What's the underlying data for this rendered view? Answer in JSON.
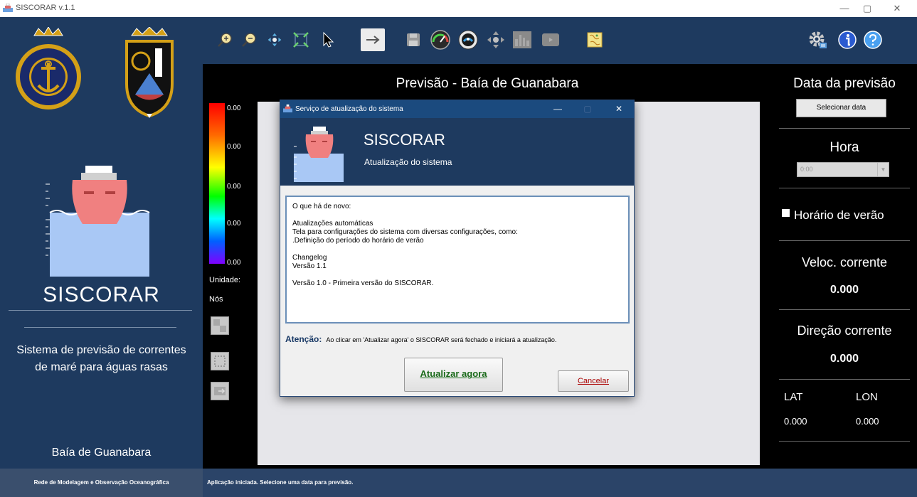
{
  "window": {
    "title": "SISCORAR v.1.1",
    "controls": {
      "minimize": "—",
      "maximize": "▢",
      "close": "✕"
    }
  },
  "sidebar": {
    "app_name": "SISCORAR",
    "description_line1": "Sistema de previsão de correntes",
    "description_line2": "de maré para águas rasas",
    "region": "Baía de Guanabara",
    "logos": [
      "marinha-do-brasil-emblem",
      "navy-ship-crest"
    ]
  },
  "toolbar": {
    "icons": [
      "zoom-in-icon",
      "zoom-out-icon",
      "pan-icon",
      "zoom-extent-icon",
      "pointer-icon",
      "arrow-icon",
      "save-icon",
      "speedometer-icon",
      "animation-icon",
      "move-icon",
      "chart-icon",
      "screen-icon",
      "map-icon",
      "settings-icon",
      "info-icon",
      "help-icon"
    ]
  },
  "main": {
    "title": "Previsão - Baía de Guanabara",
    "legend_values": [
      "0.00",
      "0.00",
      "0.00",
      "0.00",
      "0.00"
    ],
    "unit_label": "Unidade:",
    "unit_value": "Nós"
  },
  "right_panel": {
    "forecast_date_title": "Data da previsão",
    "select_date_button": "Selecionar data",
    "hour_title": "Hora",
    "hour_value": "0:00",
    "dst_label": "Horário de verão",
    "speed_title": "Veloc. corrente",
    "speed_value": "0.000",
    "direction_title": "Direção corrente",
    "direction_value": "0.000",
    "lat_label": "LAT",
    "lon_label": "LON",
    "lat_value": "0.000",
    "lon_value": "0.000"
  },
  "status": {
    "left": "Rede de Modelagem e Observação Oceanográfica",
    "message": "Aplicação iniciada. Selecione uma data para previsão."
  },
  "dialog": {
    "title": "Serviço de atualização do sistema",
    "app_name": "SISCORAR",
    "subtitle": "Atualização do sistema",
    "text_lines": {
      "l1": "O que há de novo:",
      "l2": "Atualizações automáticas",
      "l3": "Tela para configurações do sistema com diversas configurações, como:",
      "l4": ".Definição do período do horário de verão",
      "l5": "Changelog",
      "l6": "Versão 1.1",
      "l7": " Versão 1.0 - Primeira versão do SISCORAR."
    },
    "warning_label": "Atenção:",
    "warning_text": "Ao clicar em 'Atualizar agora' o SISCORAR será fechado e iniciará a atualização.",
    "update_button": "Atualizar agora",
    "cancel_button": "Cancelar"
  },
  "colors": {
    "navy": "#1e3a5f",
    "dialog_titlebar": "#1b4a7e",
    "ship_hull": "#f08080",
    "water": "#a9c8f5"
  }
}
